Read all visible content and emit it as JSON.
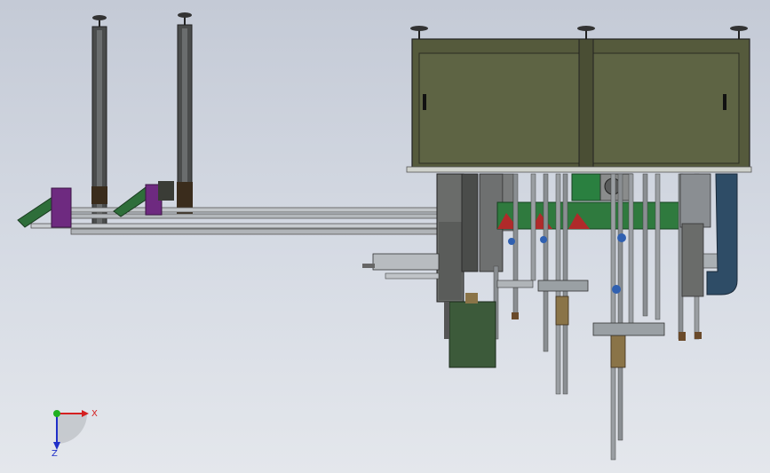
{
  "viewport": {
    "background_top": "#c4cad6",
    "background_bottom": "#e4e7ec"
  },
  "triad": {
    "x_label": "X",
    "z_label": "Z",
    "x_color": "#d42020",
    "z_color": "#1f2fc8",
    "y_color": "#20b020"
  },
  "colors": {
    "cabinet": "#555a3c",
    "cabinet_panel": "#5e6444",
    "frame": "#3a3c36",
    "rail": "#b8bcc0",
    "chute_green": "#2e6e3a",
    "chute_purple": "#6e2a80",
    "duct_blue": "#2e4c66",
    "motor_green": "#2a8040",
    "box_green": "#3c5a3a"
  }
}
